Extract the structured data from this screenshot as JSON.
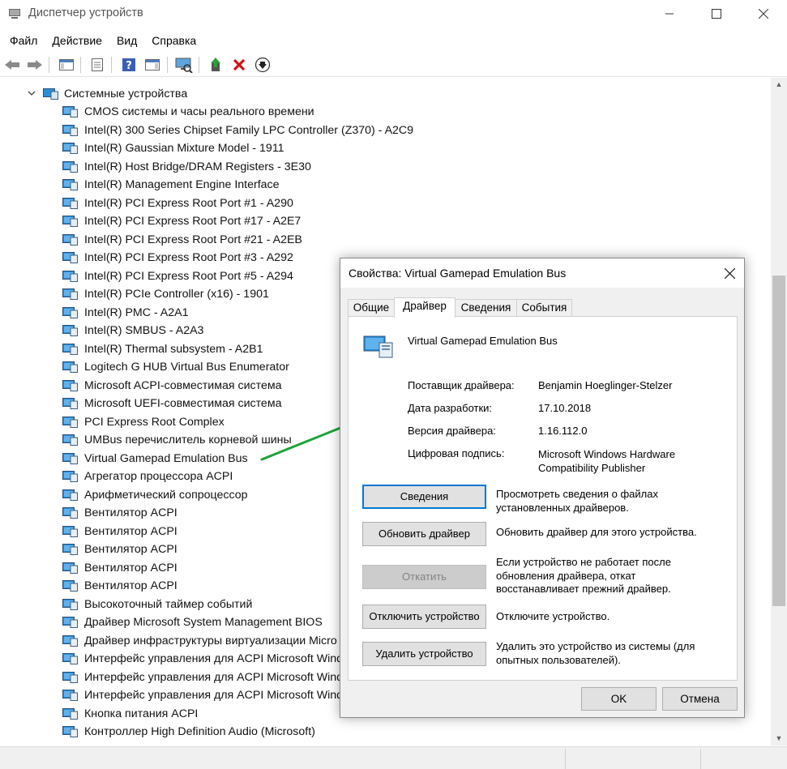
{
  "window": {
    "title": "Диспетчер устройств",
    "controls": {
      "minimize": "minimize-icon",
      "maximize": "maximize-icon",
      "close": "close-icon"
    }
  },
  "menu": [
    "Файл",
    "Действие",
    "Вид",
    "Справка"
  ],
  "toolbar": [
    {
      "name": "back-icon"
    },
    {
      "name": "forward-icon"
    },
    {
      "name": "console-tree-icon"
    },
    {
      "name": "properties-icon"
    },
    {
      "name": "help-icon"
    },
    {
      "name": "action-pane-icon"
    },
    {
      "name": "scan-hardware-icon"
    },
    {
      "name": "update-driver-icon"
    },
    {
      "name": "uninstall-icon"
    },
    {
      "name": "download-icon"
    }
  ],
  "tree": {
    "category": "Системные устройства",
    "items": [
      "CMOS системы и часы реального времени",
      "Intel(R) 300 Series Chipset Family LPC Controller (Z370) - A2C9",
      "Intel(R) Gaussian Mixture Model - 1911",
      "Intel(R) Host Bridge/DRAM Registers - 3E30",
      "Intel(R) Management Engine Interface",
      "Intel(R) PCI Express Root Port #1 - A290",
      "Intel(R) PCI Express Root Port #17 - A2E7",
      "Intel(R) PCI Express Root Port #21 - A2EB",
      "Intel(R) PCI Express Root Port #3 - A292",
      "Intel(R) PCI Express Root Port #5 - A294",
      "Intel(R) PCIe Controller (x16) - 1901",
      "Intel(R) PMC - A2A1",
      "Intel(R) SMBUS - A2A3",
      "Intel(R) Thermal subsystem - A2B1",
      "Logitech G HUB Virtual Bus Enumerator",
      "Microsoft ACPI-совместимая система",
      "Microsoft UEFI-совместимая система",
      "PCI Express Root Complex",
      "UMBus перечислитель корневой шины",
      "Virtual Gamepad Emulation Bus",
      "Агрегатор процессора ACPI",
      "Арифметический сопроцессор",
      "Вентилятор ACPI",
      "Вентилятор ACPI",
      "Вентилятор ACPI",
      "Вентилятор ACPI",
      "Вентилятор ACPI",
      "Высокоточный таймер событий",
      "Драйвер Microsoft System Management BIOS",
      "Драйвер инфраструктуры виртуализации Micro",
      "Интерфейс управления для ACPI Microsoft Wind",
      "Интерфейс управления для ACPI Microsoft Wind",
      "Интерфейс управления для ACPI Microsoft Wind",
      "Кнопка питания ACPI",
      "Контроллер High Definition Audio (Microsoft)"
    ]
  },
  "dialog": {
    "title": "Свойства: Virtual Gamepad Emulation Bus",
    "tabs": [
      "Общие",
      "Драйвер",
      "Сведения",
      "События"
    ],
    "active_tab": "Драйвер",
    "device_name": "Virtual Gamepad Emulation Bus",
    "properties": [
      {
        "label": "Поставщик драйвера:",
        "value": "Benjamin Hoeglinger-Stelzer"
      },
      {
        "label": "Дата разработки:",
        "value": "17.10.2018"
      },
      {
        "label": "Версия драйвера:",
        "value": "1.16.112.0"
      },
      {
        "label": "Цифровая подпись:",
        "value": "Microsoft Windows Hardware Compatibility Publisher"
      }
    ],
    "actions": [
      {
        "button": "Сведения",
        "desc": "Просмотреть сведения о файлах установленных драйверов."
      },
      {
        "button": "Обновить драйвер",
        "desc": "Обновить драйвер для этого устройства."
      },
      {
        "button": "Откатить",
        "desc": "Если устройство не работает после обновления драйвера, откат восстанавливает прежний драйвер."
      },
      {
        "button": "Отключить устройство",
        "desc": "Отключите устройство."
      },
      {
        "button": "Удалить устройство",
        "desc": "Удалить это устройство из системы (для опытных пользователей)."
      }
    ],
    "ok": "OK",
    "cancel": "Отмена"
  },
  "colors": {
    "annotation": "#1fa33a",
    "focus": "#0078d7",
    "device_icon": "#2a8fd8"
  }
}
